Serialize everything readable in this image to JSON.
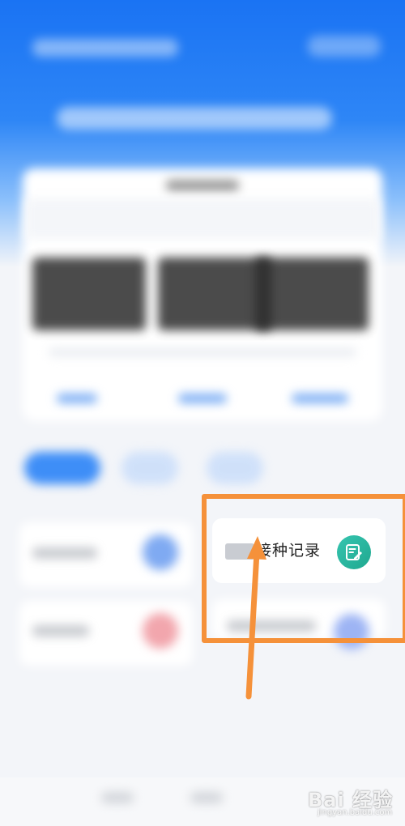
{
  "vaccination_tile": {
    "label": "接种记录",
    "icon": "edit-record-icon",
    "icon_color": "#29b89f"
  },
  "annotation": {
    "highlight_color": "#f5913a"
  },
  "watermark": {
    "main": "Bai 经验",
    "sub": "jingyan.baidu.com"
  },
  "colors": {
    "primary_blue": "#1a73f3",
    "tab_active": "#3e8ef7"
  }
}
